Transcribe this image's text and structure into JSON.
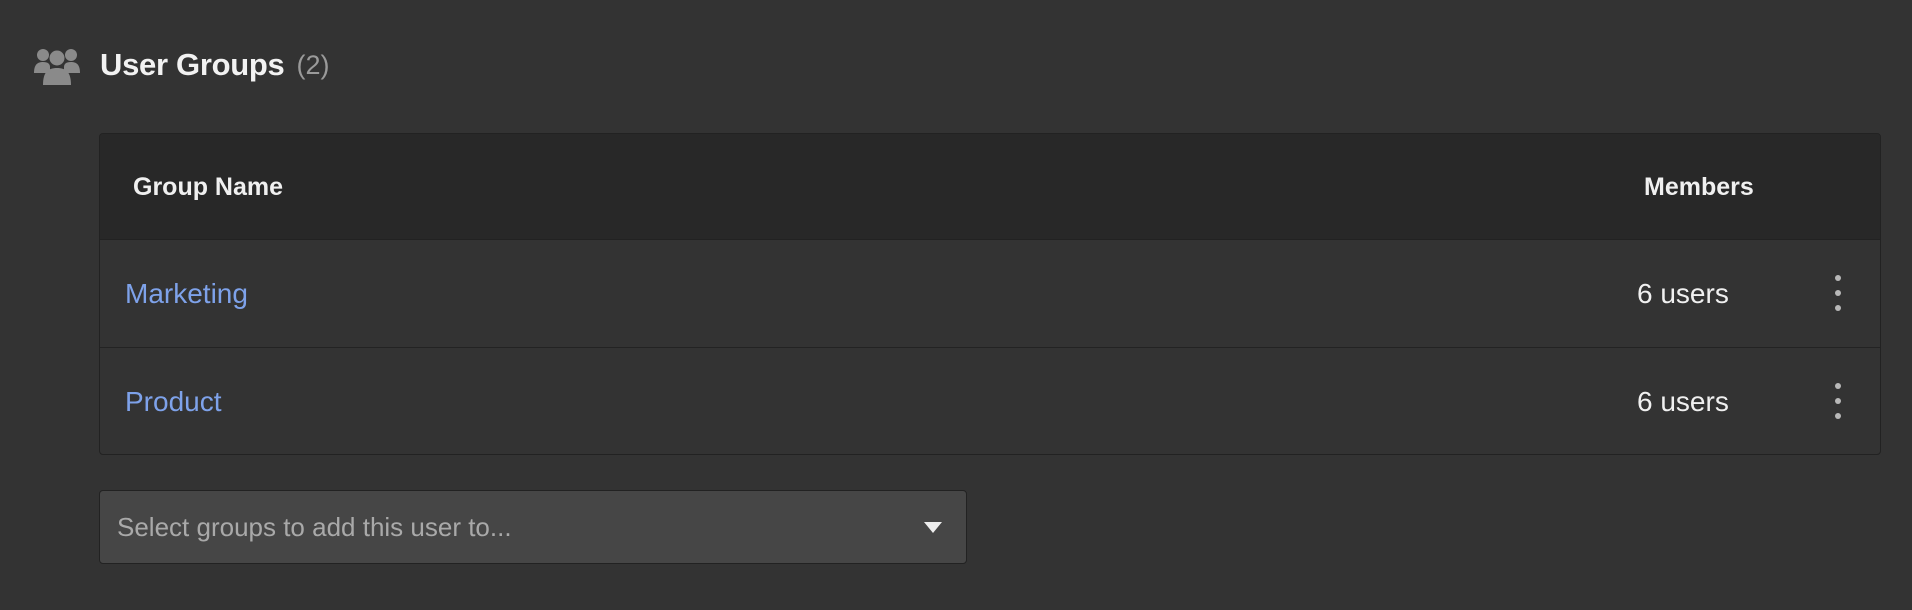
{
  "section": {
    "title": "User Groups",
    "count": "(2)",
    "icon": "users-group-icon"
  },
  "table": {
    "columns": {
      "name": "Group Name",
      "members": "Members"
    },
    "rows": [
      {
        "name": "Marketing",
        "members": "6 users"
      },
      {
        "name": "Product",
        "members": "6 users"
      }
    ]
  },
  "group_select": {
    "placeholder": "Select groups to add this user to..."
  },
  "colors": {
    "background": "#333333",
    "table_header": "#282828",
    "link": "#7ea2ea",
    "input_background": "#464646",
    "muted_text": "#9a9a9a"
  }
}
